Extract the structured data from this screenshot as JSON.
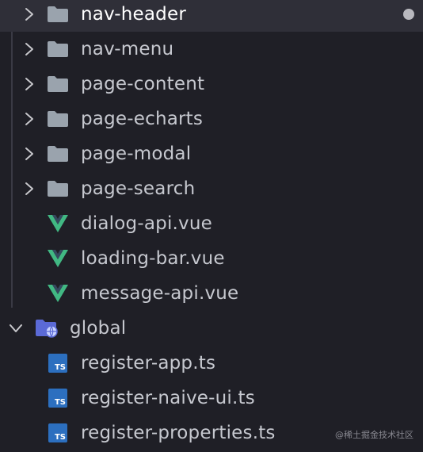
{
  "tree": {
    "folders": [
      {
        "label": "nav-header"
      },
      {
        "label": "nav-menu"
      },
      {
        "label": "page-content"
      },
      {
        "label": "page-echarts"
      },
      {
        "label": "page-modal"
      },
      {
        "label": "page-search"
      }
    ],
    "vue_files": [
      {
        "label": "dialog-api.vue"
      },
      {
        "label": "loading-bar.vue"
      },
      {
        "label": "message-api.vue"
      }
    ],
    "global_folder": {
      "label": "global"
    },
    "ts_files": [
      {
        "label": "register-app.ts"
      },
      {
        "label": "register-naive-ui.ts"
      },
      {
        "label": "register-properties.ts"
      }
    ],
    "ts_icon_text": "TS"
  },
  "colors": {
    "background": "#1f1f26",
    "selected_row": "#2f2f38",
    "folder": "#9aa3ad",
    "vue_green": "#41b883",
    "vue_dark": "#35495e",
    "ts_blue": "#2c6fbf",
    "global_folder": "#5b6ad6"
  },
  "watermark": "@稀土掘金技术社区"
}
